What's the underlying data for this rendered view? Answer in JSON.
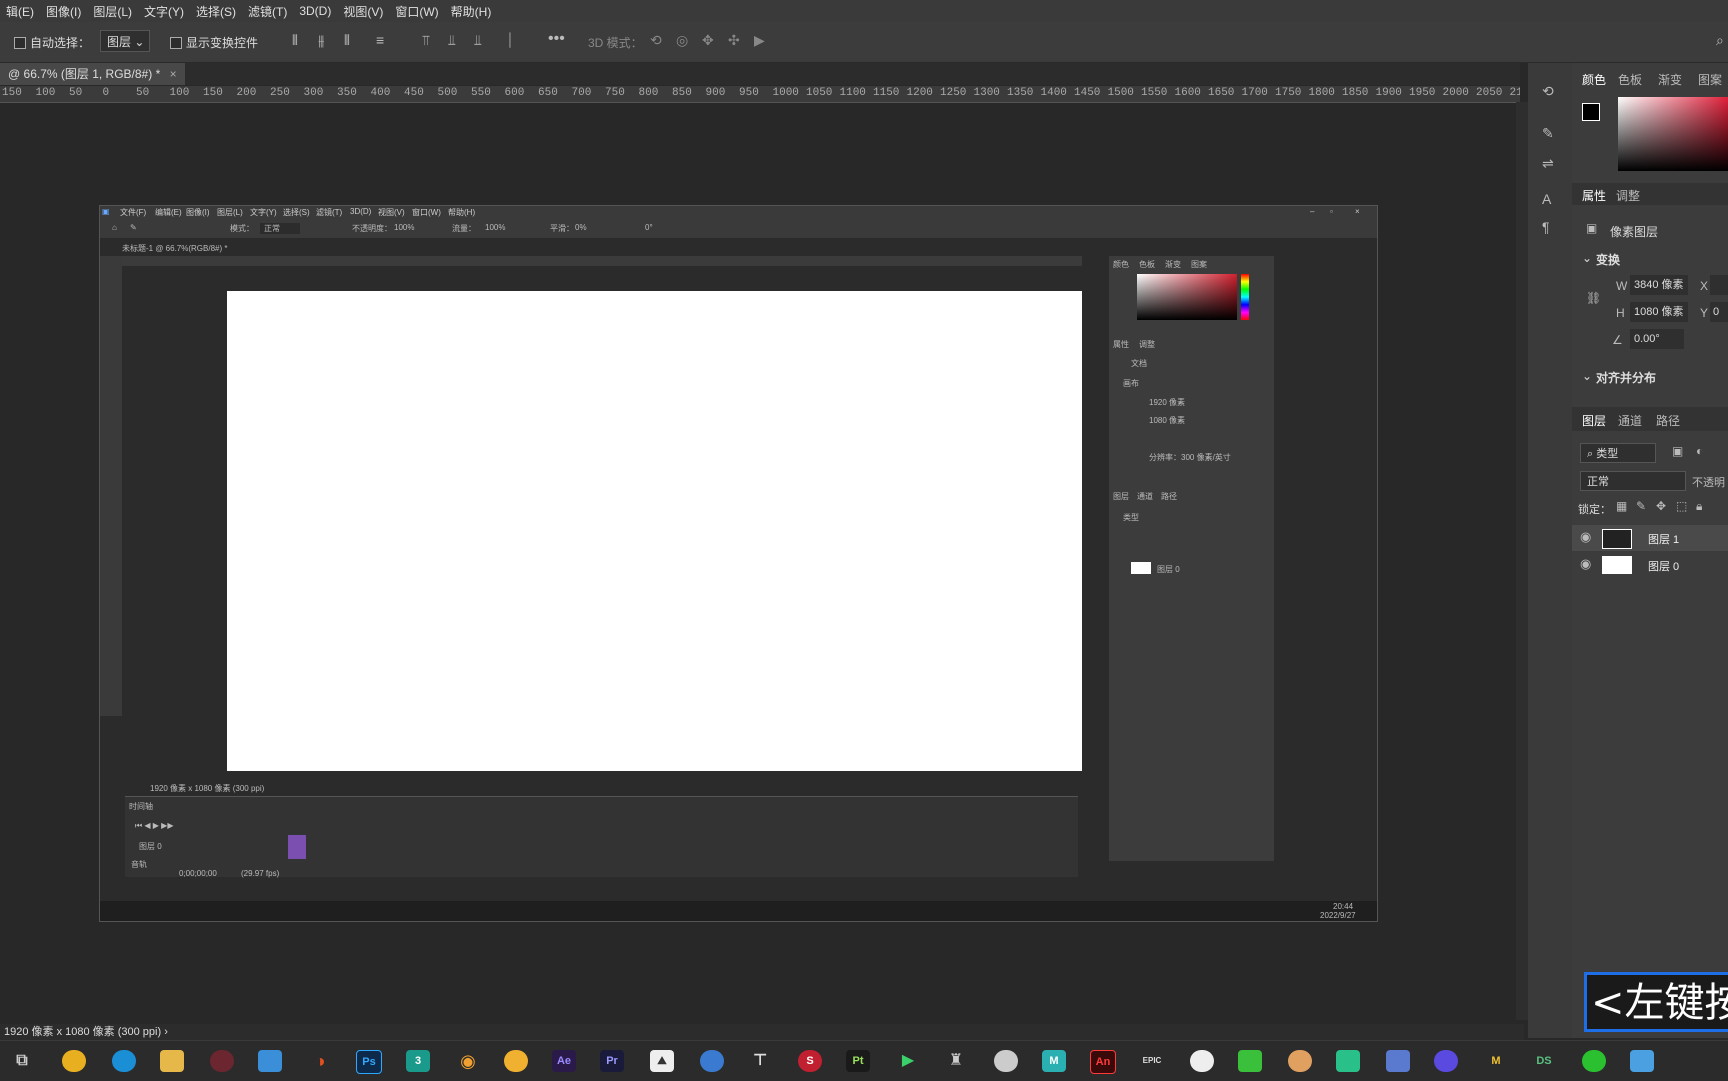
{
  "menubar": [
    "辑(E)",
    "图像(I)",
    "图层(L)",
    "文字(Y)",
    "选择(S)",
    "滤镜(T)",
    "3D(D)",
    "视图(V)",
    "窗口(W)",
    "帮助(H)"
  ],
  "options": {
    "auto_select": "自动选择：",
    "layer_dropdown": "图层",
    "show_transform": "显示变换控件",
    "mode_3d": "3D 模式："
  },
  "document_tab": "@ 66.7% (图层 1, RGB/8#) *",
  "ruler_labels": [
    "150",
    "100",
    "50",
    "0",
    "50",
    "100",
    "150",
    "200",
    "250",
    "300",
    "350",
    "400",
    "450",
    "500",
    "550",
    "600",
    "650",
    "700",
    "750",
    "800",
    "850",
    "900",
    "950",
    "1000",
    "1050",
    "1100",
    "1150",
    "1200",
    "1250",
    "1300",
    "1350",
    "1400",
    "1450",
    "1500",
    "1550",
    "1600",
    "1650",
    "1700",
    "1750",
    "1800",
    "1850",
    "1900",
    "1950",
    "2000",
    "2050",
    "210"
  ],
  "right_panel": {
    "color_tabs": [
      "颜色",
      "色板",
      "渐变",
      "图案"
    ],
    "props_tabs": [
      "属性",
      "调整"
    ],
    "pixel_layer": "像素图层",
    "transform": "变换",
    "w_label": "W",
    "w_value": "3840 像素",
    "h_label": "H",
    "h_value": "1080 像素",
    "x_label": "X",
    "y_label": "Y",
    "y_value": "0",
    "angle": "0.00°",
    "align": "对齐并分布",
    "layer_tabs": [
      "图层",
      "通道",
      "路径"
    ],
    "kind": "类型",
    "blend": "正常",
    "opacity_label": "不透明",
    "lock": "锁定：",
    "layers": [
      "图层 1",
      "图层 0"
    ]
  },
  "status": "1920 像素 x 1080 像素 (300 ppi)",
  "inner": {
    "menu": [
      "文件(F)",
      "编辑(E)",
      "图像(I)",
      "图层(L)",
      "文字(Y)",
      "选择(S)",
      "滤镜(T)",
      "3D(D)",
      "视图(V)",
      "窗口(W)",
      "帮助(H)"
    ],
    "mode_label": "模式：",
    "mode_value": "正常",
    "opacity": "不透明度：",
    "opacity_val": "100%",
    "flow": "流量：",
    "flow_val": "100%",
    "smooth": "平滑：",
    "smooth_val": "0%",
    "angle_val": "0°",
    "tab": "未标题-1 @ 66.7%(RGB/8#) *",
    "status": "1920 像素 x 1080 像素 (300 ppi)",
    "timeline_title": "时间轴",
    "track": "图层 0",
    "audio": "音轨",
    "timecode": "0;00;00;00",
    "fps": "(29.97 fps)",
    "panel_tabs": [
      "颜色",
      "色板",
      "渐变",
      "图案"
    ],
    "props_tabs": [
      "属性",
      "调整"
    ],
    "doc": "文档",
    "canvas_label": "画布",
    "w": "1920 像素",
    "h": "1080 像素",
    "resolution": "分辨率：300 像素/英寸",
    "layer_tabs": [
      "图层",
      "通道",
      "路径"
    ],
    "kind": "类型",
    "layer": "图层 0",
    "clock_time": "20:44",
    "clock_date": "2022/9/27"
  },
  "caption": "<左键按",
  "taskbar_apps": [
    "Ps",
    "3",
    "Ae",
    "Pr",
    "Pt",
    "An",
    "EPIC",
    "M",
    "DS"
  ]
}
